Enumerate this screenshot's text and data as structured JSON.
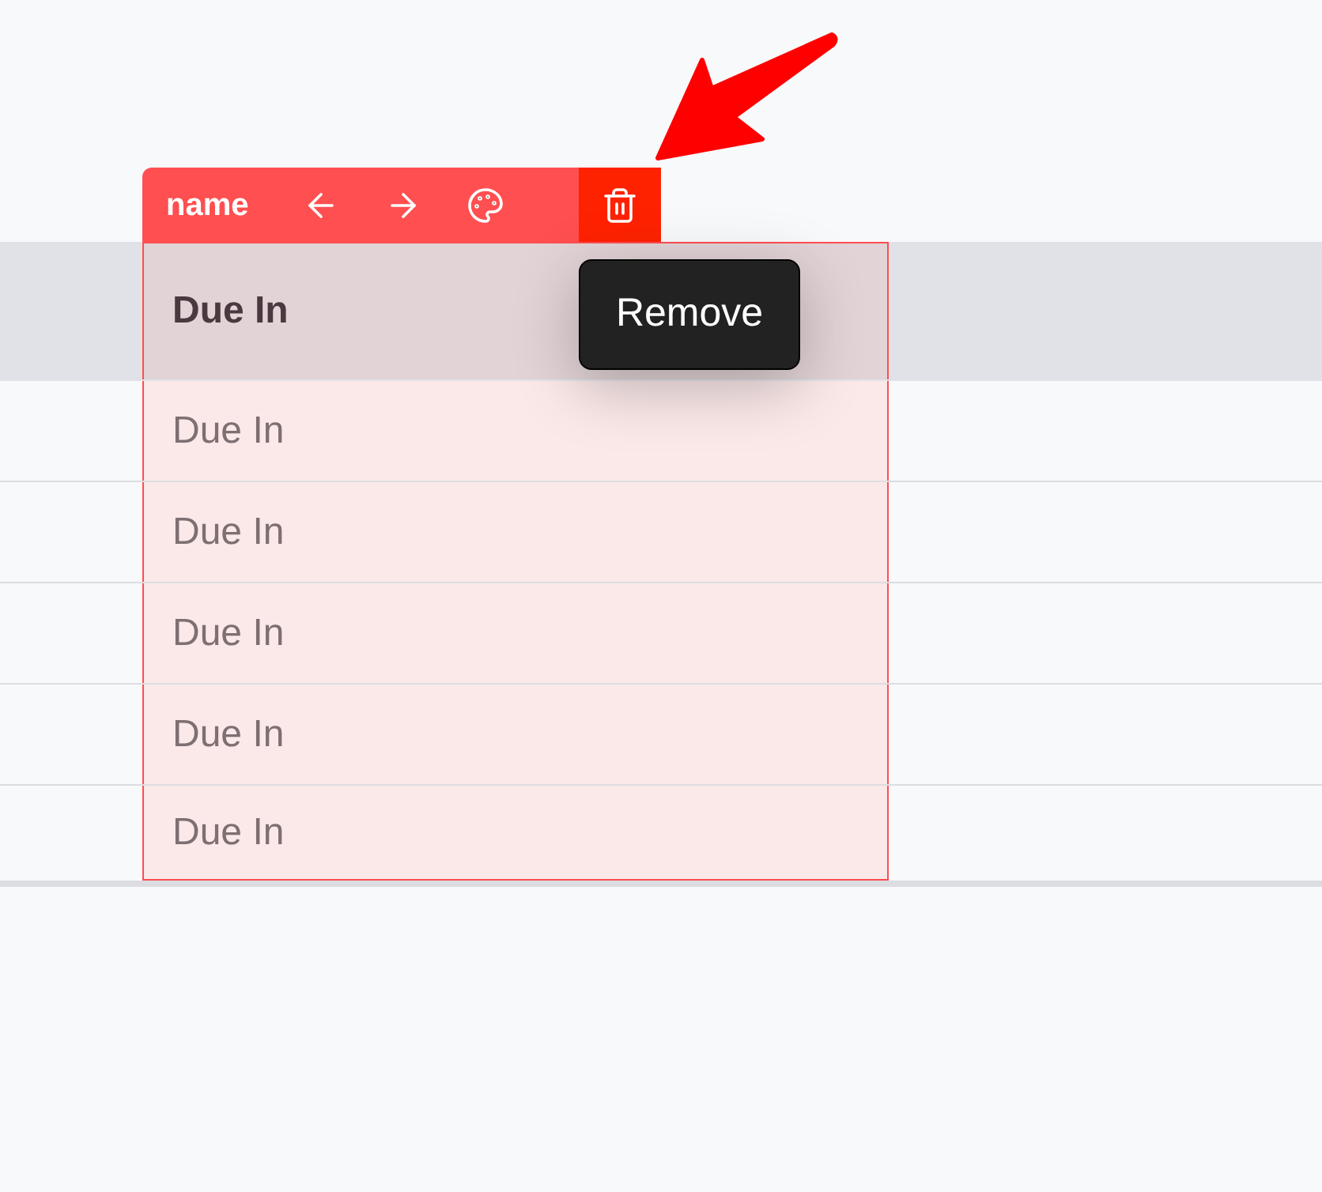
{
  "column_toolbar": {
    "label": "name",
    "buttons": [
      {
        "kind": "left",
        "hovered": false
      },
      {
        "kind": "right",
        "hovered": false
      },
      {
        "kind": "palette",
        "hovered": false
      },
      {
        "kind": "delete",
        "hovered": true
      }
    ]
  },
  "tooltip": {
    "text": "Remove"
  },
  "table": {
    "column": {
      "selected": true,
      "header": "Due In",
      "cells": [
        "Due In",
        "Due In",
        "Due In",
        "Due In",
        "Due In"
      ]
    }
  }
}
